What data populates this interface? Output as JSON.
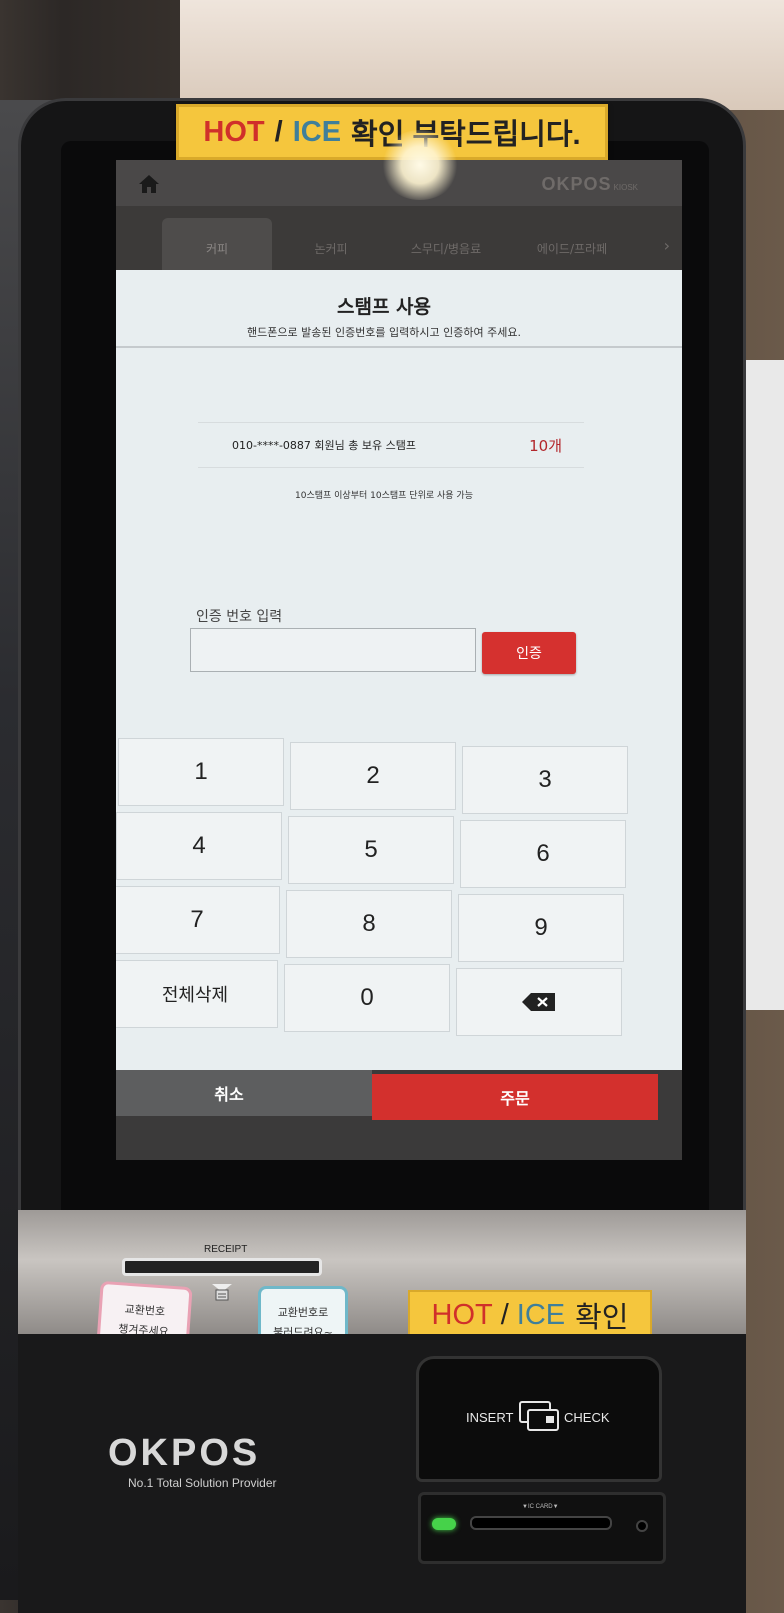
{
  "top_sticker": {
    "hot": "HOT",
    "slash": "/",
    "ice": "ICE",
    "rest": "확인 부탁드립니다."
  },
  "header": {
    "brand": "OKPOS",
    "brand_sub": "KIOSK",
    "home_icon": "home-icon"
  },
  "tabs": [
    {
      "label": "커피",
      "active": true
    },
    {
      "label": "논커피",
      "active": false
    },
    {
      "label": "스무디/병음료",
      "active": false
    },
    {
      "label": "에이드/프라페",
      "active": false
    }
  ],
  "panel": {
    "title": "스탬프 사용",
    "subtitle": "핸드폰으로 발송된 인증번호를 입력하시고 인증하여 주세요.",
    "stamp_label": "010-****-0887 회원님 총 보유 스탬프",
    "stamp_count": "10개",
    "stamp_note": "10스탬프 이상부터 10스탬프 단위로 사용 가능",
    "auth_label": "인증 번호 입력",
    "auth_value": "",
    "auth_button": "인증"
  },
  "keypad": {
    "keys": [
      "1",
      "2",
      "3",
      "4",
      "5",
      "6",
      "7",
      "8",
      "9",
      "전체삭제",
      "0"
    ],
    "backspace_icon": "backspace-icon"
  },
  "actions": {
    "cancel": "취소",
    "order": "주문"
  },
  "hardware": {
    "receipt_label": "RECEIPT",
    "note_left": [
      "교환번호",
      "챙겨주세요"
    ],
    "note_right": [
      "교환번호로",
      "불러드려요~"
    ],
    "bottom_sticker": {
      "hot": "HOT",
      "slash": "/",
      "ice": "ICE",
      "rest": "확인"
    },
    "logo": "OKPOS",
    "tagline": "No.1 Total Solution Provider",
    "insert": "INSERT",
    "check": "CHECK",
    "ic_card": "▼IC CARD▼"
  },
  "colors": {
    "accent": "#d5312f",
    "cancel_bg": "#5d5e5f",
    "sticker": "#f5c63d"
  }
}
